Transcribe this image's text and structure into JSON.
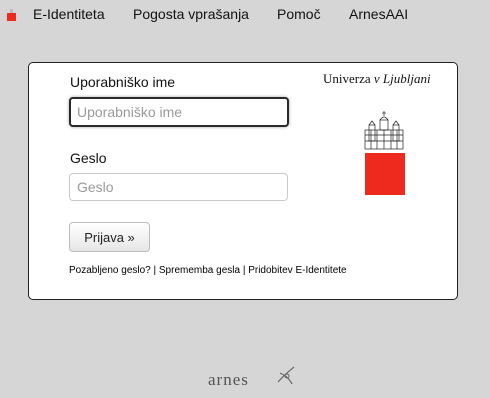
{
  "nav": {
    "items": [
      {
        "label": "E-Identiteta"
      },
      {
        "label": "Pogosta vprašanja"
      },
      {
        "label": "Pomoč"
      },
      {
        "label": "ArnesAAI"
      }
    ]
  },
  "login": {
    "username_label": "Uporabniško ime",
    "username_placeholder": "Uporabniško ime",
    "username_value": "",
    "password_label": "Geslo",
    "password_placeholder": "Geslo",
    "password_value": "",
    "submit_label": "Prijava »"
  },
  "links": {
    "forgot": "Pozabljeno geslo?",
    "sep1": " | ",
    "change": "Sprememba gesla",
    "sep2": " | ",
    "obtain": "Pridobitev E-Identitete"
  },
  "university": {
    "name_part1": "Univerza ",
    "name_part2": "v Ljubljani"
  },
  "footer": {
    "brand": "arnes"
  },
  "colors": {
    "logo_red": "#ee2a1e",
    "background": "#d6d6d6"
  }
}
